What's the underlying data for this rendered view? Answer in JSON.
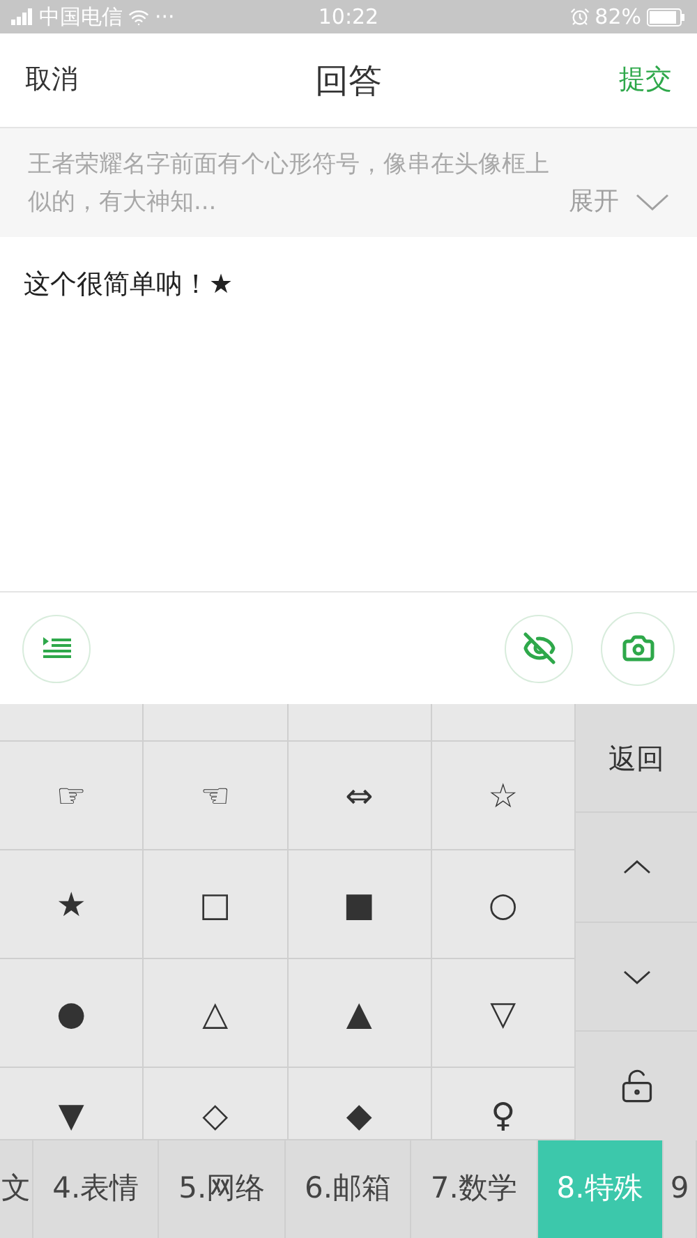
{
  "status_bar": {
    "carrier": "中国电信",
    "dots": "···",
    "time": "10:22",
    "battery": "82%"
  },
  "header": {
    "cancel": "取消",
    "title": "回答",
    "submit": "提交"
  },
  "question": {
    "text": "王者荣耀名字前面有个心形符号，像串在头像框上似的，有大神知...",
    "expand": "展开"
  },
  "answer": {
    "value": "这个很简单呐！★"
  },
  "keyboard": {
    "rows": [
      [
        "☞",
        "☜",
        "⇔",
        "☆"
      ],
      [
        "★",
        "□",
        "■",
        "○"
      ],
      [
        "●",
        "△",
        "▲",
        "▽"
      ],
      [
        "▼",
        "◇",
        "◆",
        "♀"
      ]
    ],
    "back": "返回",
    "categories": [
      {
        "label": "文",
        "selected": false
      },
      {
        "label": "4.表情",
        "selected": false
      },
      {
        "label": "5.网络",
        "selected": false
      },
      {
        "label": "6.邮箱",
        "selected": false
      },
      {
        "label": "7.数学",
        "selected": false
      },
      {
        "label": "8.特殊",
        "selected": true
      },
      {
        "label": "9",
        "selected": false
      }
    ]
  }
}
